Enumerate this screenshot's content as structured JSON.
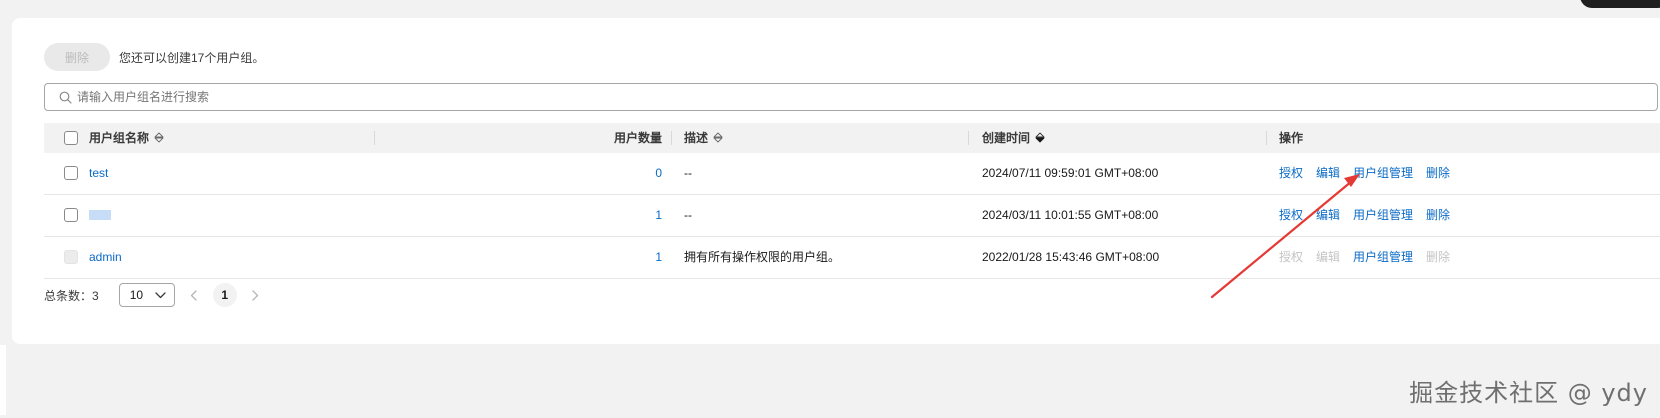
{
  "toolbar": {
    "delete_label": "删除",
    "quota_text": "您还可以创建17个用户组。"
  },
  "search": {
    "placeholder": "请输入用户组名进行搜索"
  },
  "table": {
    "headers": {
      "name": "用户组名称",
      "user_count": "用户数量",
      "description": "描述",
      "created_at": "创建时间",
      "actions": "操作"
    },
    "rows": [
      {
        "name": "test",
        "user_count": "0",
        "description": "--",
        "created_at": "2024/07/11 09:59:01 GMT+08:00",
        "actions": {
          "authorize": "授权",
          "edit": "编辑",
          "manage_users": "用户组管理",
          "delete": "删除"
        },
        "checkbox_disabled": false,
        "authorize_enabled": true,
        "edit_enabled": true,
        "delete_enabled": true
      },
      {
        "name": "",
        "user_count": "1",
        "description": "--",
        "created_at": "2024/03/11 10:01:55 GMT+08:00",
        "actions": {
          "authorize": "授权",
          "edit": "编辑",
          "manage_users": "用户组管理",
          "delete": "删除"
        },
        "checkbox_disabled": false,
        "authorize_enabled": true,
        "edit_enabled": true,
        "delete_enabled": true
      },
      {
        "name": "admin",
        "user_count": "1",
        "description": "拥有所有操作权限的用户组。",
        "created_at": "2022/01/28 15:43:46 GMT+08:00",
        "actions": {
          "authorize": "授权",
          "edit": "编辑",
          "manage_users": "用户组管理",
          "delete": "删除"
        },
        "checkbox_disabled": true,
        "authorize_enabled": false,
        "edit_enabled": false,
        "delete_enabled": false
      }
    ]
  },
  "pagination": {
    "total_label": "总条数：3",
    "page_size": "10",
    "current_page": "1"
  },
  "watermark": "掘金技术社区 @ ydy",
  "colors": {
    "link": "#0b6bc7",
    "disabled_link": "#c4c4c4",
    "annotation_arrow": "#e53935",
    "header_bg": "#f2f2f2"
  }
}
